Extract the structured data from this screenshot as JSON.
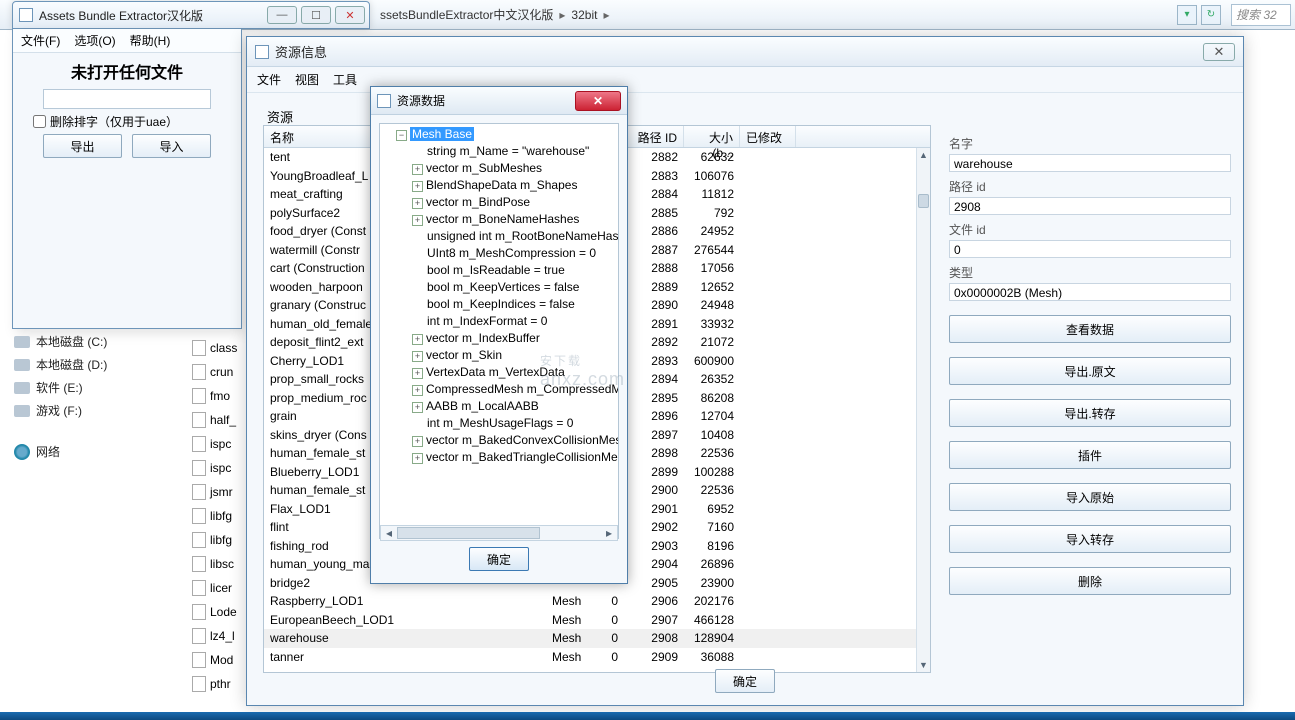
{
  "addressbar": {
    "crumb1": "ssetsBundleExtractor中文汉化版",
    "crumb2": "32bit",
    "search_placeholder": "搜索 32"
  },
  "mainwin": {
    "title": "Assets Bundle Extractor汉化版",
    "menu": {
      "file": "文件(F)",
      "options": "选项(O)",
      "help": "帮助(H)"
    },
    "hint": "未打开任何文件",
    "checkbox": "删除排字（仅用于uae）",
    "btn_export": "导出",
    "btn_import": "导入"
  },
  "explorer": {
    "drives": [
      "本地磁盘 (C:)",
      "本地磁盘 (D:)",
      "软件 (E:)",
      "游戏 (F:)"
    ],
    "network": "网络",
    "files": [
      "class",
      "crun",
      "fmo",
      "half_",
      "ispc",
      "ispc",
      "jsmr",
      "libfg",
      "libfg",
      "libsc",
      "licer",
      "Lode",
      "lz4_l",
      "Mod",
      "pthr"
    ]
  },
  "resinfo": {
    "title": "资源信息",
    "menu": {
      "file": "文件",
      "view": "视图",
      "tools": "工具"
    },
    "label_resource": "资源",
    "ok": "确定",
    "headers": {
      "name": "名称",
      "type": "",
      "fid": "",
      "pid": "路径 ID",
      "size": "大小 (b...",
      "mod": "已修改"
    },
    "rows": [
      {
        "name": "tent",
        "type": "",
        "fid": "",
        "pid": "2882",
        "size": "62632",
        "mod": ""
      },
      {
        "name": "YoungBroadleaf_L",
        "type": "",
        "fid": "",
        "pid": "2883",
        "size": "106076",
        "mod": ""
      },
      {
        "name": "meat_crafting",
        "type": "",
        "fid": "",
        "pid": "2884",
        "size": "11812",
        "mod": ""
      },
      {
        "name": "polySurface2",
        "type": "",
        "fid": "",
        "pid": "2885",
        "size": "792",
        "mod": ""
      },
      {
        "name": "food_dryer (Const",
        "type": "",
        "fid": "",
        "pid": "2886",
        "size": "24952",
        "mod": ""
      },
      {
        "name": "watermill (Constr",
        "type": "",
        "fid": "",
        "pid": "2887",
        "size": "276544",
        "mod": ""
      },
      {
        "name": "cart (Construction",
        "type": "",
        "fid": "",
        "pid": "2888",
        "size": "17056",
        "mod": ""
      },
      {
        "name": "wooden_harpoon",
        "type": "",
        "fid": "",
        "pid": "2889",
        "size": "12652",
        "mod": ""
      },
      {
        "name": "granary (Construc",
        "type": "",
        "fid": "",
        "pid": "2890",
        "size": "24948",
        "mod": ""
      },
      {
        "name": "human_old_female",
        "type": "",
        "fid": "",
        "pid": "2891",
        "size": "33932",
        "mod": ""
      },
      {
        "name": "deposit_flint2_ext",
        "type": "",
        "fid": "",
        "pid": "2892",
        "size": "21072",
        "mod": ""
      },
      {
        "name": "Cherry_LOD1",
        "type": "",
        "fid": "",
        "pid": "2893",
        "size": "600900",
        "mod": ""
      },
      {
        "name": "prop_small_rocks",
        "type": "",
        "fid": "",
        "pid": "2894",
        "size": "26352",
        "mod": ""
      },
      {
        "name": "prop_medium_roc",
        "type": "",
        "fid": "",
        "pid": "2895",
        "size": "86208",
        "mod": ""
      },
      {
        "name": "grain",
        "type": "",
        "fid": "",
        "pid": "2896",
        "size": "12704",
        "mod": ""
      },
      {
        "name": "skins_dryer (Cons",
        "type": "",
        "fid": "",
        "pid": "2897",
        "size": "10408",
        "mod": ""
      },
      {
        "name": "human_female_st",
        "type": "",
        "fid": "",
        "pid": "2898",
        "size": "22536",
        "mod": ""
      },
      {
        "name": "Blueberry_LOD1",
        "type": "",
        "fid": "",
        "pid": "2899",
        "size": "100288",
        "mod": ""
      },
      {
        "name": "human_female_st",
        "type": "",
        "fid": "",
        "pid": "2900",
        "size": "22536",
        "mod": ""
      },
      {
        "name": "Flax_LOD1",
        "type": "",
        "fid": "",
        "pid": "2901",
        "size": "6952",
        "mod": ""
      },
      {
        "name": "flint",
        "type": "",
        "fid": "",
        "pid": "2902",
        "size": "7160",
        "mod": ""
      },
      {
        "name": "fishing_rod",
        "type": "",
        "fid": "",
        "pid": "2903",
        "size": "8196",
        "mod": ""
      },
      {
        "name": "human_young_ma",
        "type": "",
        "fid": "",
        "pid": "2904",
        "size": "26896",
        "mod": ""
      },
      {
        "name": "bridge2",
        "type": "",
        "fid": "",
        "pid": "2905",
        "size": "23900",
        "mod": ""
      },
      {
        "name": "Raspberry_LOD1",
        "type": "Mesh",
        "fid": "0",
        "pid": "2906",
        "size": "202176",
        "mod": ""
      },
      {
        "name": "EuropeanBeech_LOD1",
        "type": "Mesh",
        "fid": "0",
        "pid": "2907",
        "size": "466128",
        "mod": ""
      },
      {
        "name": "warehouse",
        "type": "Mesh",
        "fid": "0",
        "pid": "2908",
        "size": "128904",
        "mod": "",
        "sel": true
      },
      {
        "name": "tanner",
        "type": "Mesh",
        "fid": "0",
        "pid": "2909",
        "size": "36088",
        "mod": ""
      }
    ],
    "details": {
      "name_lbl": "名字",
      "name_val": "warehouse",
      "pid_lbl": "路径 id",
      "pid_val": "2908",
      "fid_lbl": "文件 id",
      "fid_val": "0",
      "type_lbl": "类型",
      "type_val": "0x0000002B (Mesh)",
      "btns": [
        "查看数据",
        "导出.原文",
        "导出.转存",
        "插件",
        "导入原始",
        "导入转存",
        "删除"
      ]
    }
  },
  "resdata": {
    "title": "资源数据",
    "root": "Mesh Base",
    "nodes": [
      {
        "t": "string m_Name = \"warehouse\"",
        "e": ""
      },
      {
        "t": "vector m_SubMeshes",
        "e": "+"
      },
      {
        "t": "BlendShapeData m_Shapes",
        "e": "+"
      },
      {
        "t": "vector m_BindPose",
        "e": "+"
      },
      {
        "t": "vector m_BoneNameHashes",
        "e": "+"
      },
      {
        "t": "unsigned int m_RootBoneNameHash",
        "e": ""
      },
      {
        "t": "UInt8 m_MeshCompression = 0",
        "e": ""
      },
      {
        "t": "bool m_IsReadable = true",
        "e": ""
      },
      {
        "t": "bool m_KeepVertices = false",
        "e": ""
      },
      {
        "t": "bool m_KeepIndices = false",
        "e": ""
      },
      {
        "t": "int m_IndexFormat = 0",
        "e": ""
      },
      {
        "t": "vector m_IndexBuffer",
        "e": "+"
      },
      {
        "t": "vector m_Skin",
        "e": "+"
      },
      {
        "t": "VertexData m_VertexData",
        "e": "+"
      },
      {
        "t": "CompressedMesh m_CompressedMe",
        "e": "+"
      },
      {
        "t": "AABB m_LocalAABB",
        "e": "+"
      },
      {
        "t": "int m_MeshUsageFlags = 0",
        "e": ""
      },
      {
        "t": "vector m_BakedConvexCollisionMesh",
        "e": "+"
      },
      {
        "t": "vector m_BakedTriangleCollisionMes",
        "e": "+"
      }
    ],
    "ok": "确定"
  },
  "watermark": {
    "main": "安下载",
    "sub": "anxz.com"
  }
}
